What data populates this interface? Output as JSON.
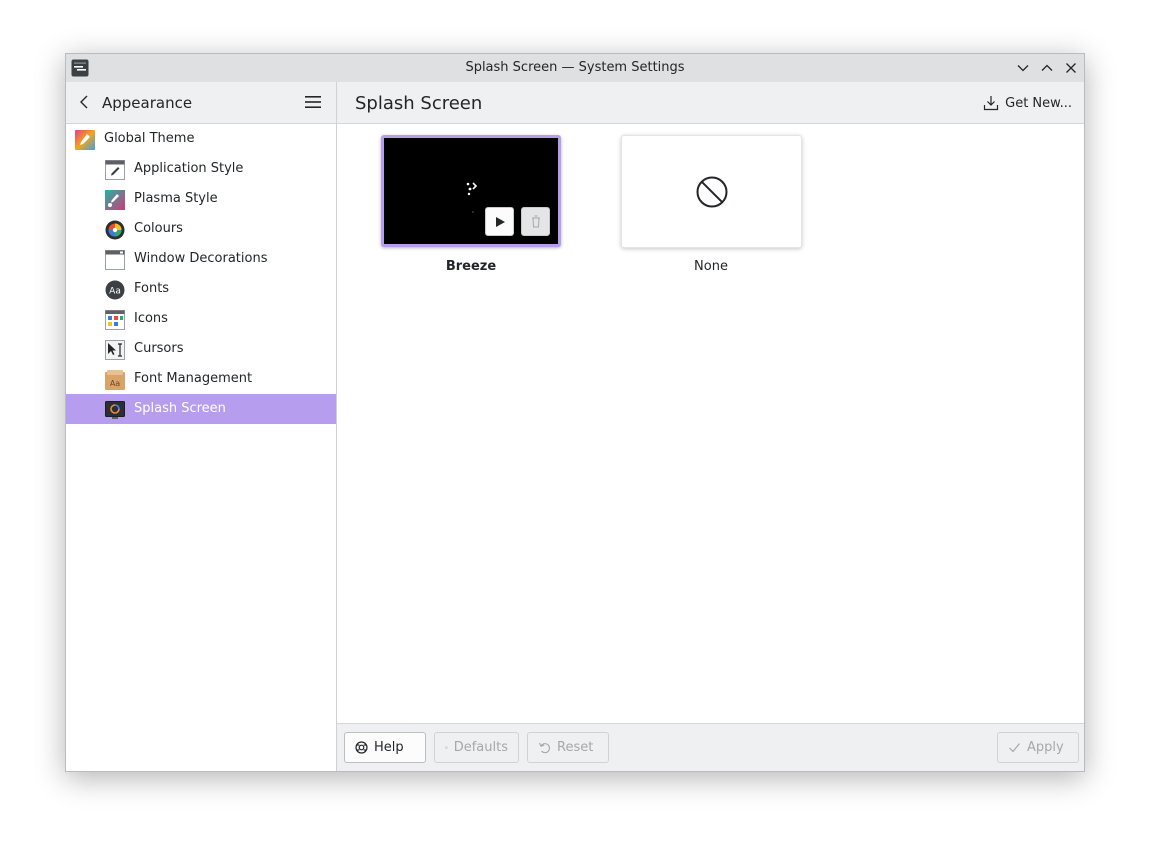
{
  "window": {
    "title": "Splash Screen — System Settings"
  },
  "sidebar": {
    "back_title": "Appearance",
    "items": [
      {
        "label": "Global Theme",
        "icon": "global-theme-icon"
      },
      {
        "label": "Application Style",
        "icon": "application-style-icon"
      },
      {
        "label": "Plasma Style",
        "icon": "plasma-style-icon"
      },
      {
        "label": "Colours",
        "icon": "colours-icon"
      },
      {
        "label": "Window Decorations",
        "icon": "window-decorations-icon"
      },
      {
        "label": "Fonts",
        "icon": "fonts-icon",
        "glyph": "Aa"
      },
      {
        "label": "Icons",
        "icon": "icons-icon"
      },
      {
        "label": "Cursors",
        "icon": "cursors-icon"
      },
      {
        "label": "Font Management",
        "icon": "font-management-icon",
        "glyph": "Aa"
      },
      {
        "label": "Splash Screen",
        "icon": "splash-screen-icon",
        "selected": true
      }
    ]
  },
  "main": {
    "title": "Splash Screen",
    "get_new_label": "Get New...",
    "themes": [
      {
        "name": "Breeze",
        "selected": true
      },
      {
        "name": "None",
        "selected": false
      }
    ]
  },
  "footer": {
    "help_label": "Help",
    "defaults_label": "Defaults",
    "reset_label": "Reset",
    "apply_label": "Apply"
  },
  "colors": {
    "accent": "#b69ded",
    "header_bg": "#eff0f1",
    "titlebar_bg": "#dee0e2",
    "text": "#232629",
    "disabled_text": "#a5a8ab"
  }
}
